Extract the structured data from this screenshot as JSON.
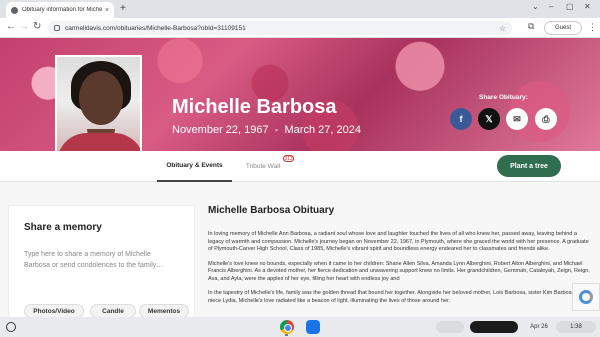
{
  "browser": {
    "tab_title": "Obituary information for Miche",
    "tab_close": "×",
    "new_tab": "+",
    "url": "carmelldavis.com/obituaries/Michelle-Barbosa?obId=31109151",
    "profile": "Guest",
    "window_controls": [
      "⌄",
      "–",
      "▢",
      "✕"
    ]
  },
  "hero": {
    "name": "Michelle Barbosa",
    "dates": "November 22, 1967  -  March 27, 2024",
    "share_label": "Share Obituary:",
    "share_buttons": [
      {
        "icon": "facebook-icon",
        "glyph": "f",
        "bg": "#3b5998",
        "fg": "#ffffff"
      },
      {
        "icon": "x-icon",
        "glyph": "𝕏",
        "bg": "#111111",
        "fg": "#ffffff"
      },
      {
        "icon": "email-icon",
        "glyph": "✉",
        "bg": "#ffffff",
        "fg": "#444444"
      },
      {
        "icon": "print-icon",
        "glyph": "⎙",
        "bg": "#ffffff",
        "fg": "#444444"
      }
    ]
  },
  "tabs": {
    "active": "Obituary & Events",
    "tribute": "Tribute Wall",
    "tribute_badge": "313",
    "plant_tree": "Plant a tree"
  },
  "memory": {
    "title": "Share a memory",
    "placeholder": "Type here to share a memory of Michelle Barbosa or send condolences to the family…",
    "chips": [
      "Photos/Video",
      "Candle",
      "Mementos"
    ]
  },
  "obituary": {
    "title": "Michelle Barbosa Obituary",
    "paragraphs": [
      "In loving memory of Michelle Ann Barbosa, a radiant soul whose love and laughter touched the lives of all who knew her, passed away, leaving behind a legacy of warmth and compassion. Michelle's journey began on November 22, 1967, in Plymouth, where she graced the world with her presence. A graduate of Plymouth-Carver High School, Class of 1985, Michelle's vibrant spirit and boundless energy endeared her to classmates and friends alike.",
      "Michelle's love knew no bounds, especially when it came to her children: Shane Allen Silva, Amanda Lynn Alberghini, Robert Alton Alberghini, and Michael Francis Alberghini. As a devoted mother, her fierce dedication and unwavering support knew no limits. Her grandchildren, Gemmah, Cataleyah, Zeign, Reign, Ava, and Ayla, were the apples of her eye, filling her heart with endless joy and",
      "In the tapestry of Michelle's life, family was the golden thread that bound her together. Alongside her beloved mother, Lois Barbosa, sister Kim Barbosa, and niece Lydia, Michelle's love radiated like a beacon of light, illuminating the lives of those around her."
    ]
  },
  "shelf": {
    "date": "Apr 26",
    "time": "1:38"
  }
}
